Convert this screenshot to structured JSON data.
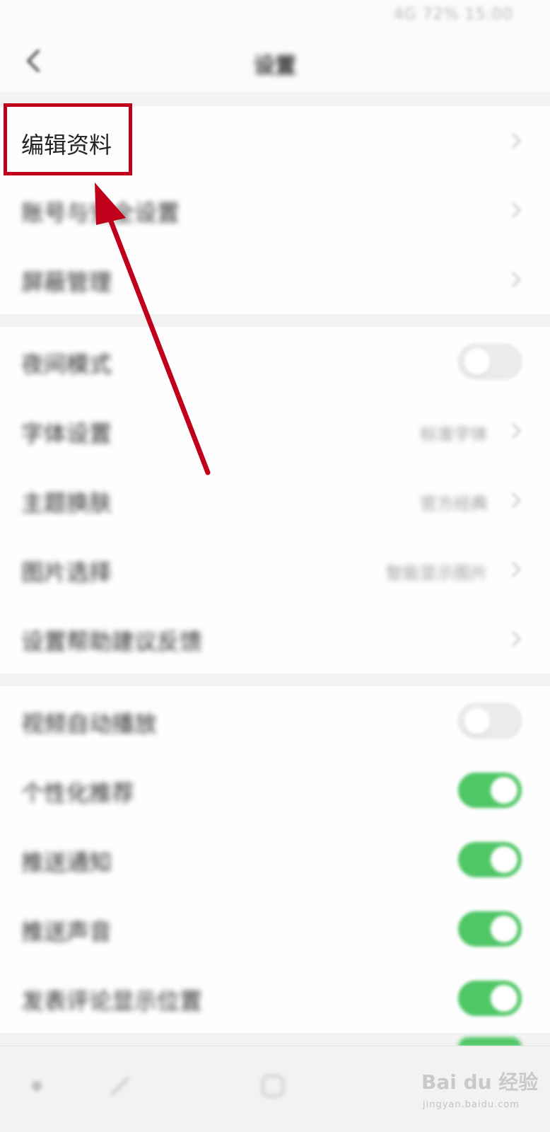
{
  "status_bar": {
    "text": "4G 72% 15:00"
  },
  "header": {
    "title": "设置"
  },
  "groups": [
    {
      "rows": [
        {
          "label": "编辑资料",
          "control": "chevron"
        },
        {
          "label": "账号与安全设置",
          "control": "chevron"
        },
        {
          "label": "屏蔽管理",
          "control": "chevron"
        }
      ]
    },
    {
      "rows": [
        {
          "label": "夜间模式",
          "control": "toggle-off"
        },
        {
          "label": "字体设置",
          "value": "标准字体",
          "control": "chevron"
        },
        {
          "label": "主题换肤",
          "value": "官方经典",
          "control": "chevron"
        },
        {
          "label": "图片选择",
          "value": "智能显示图片",
          "control": "chevron"
        },
        {
          "label": "设置帮助建议反馈",
          "control": "chevron"
        }
      ]
    },
    {
      "rows": [
        {
          "label": "视频自动播放",
          "control": "toggle-off"
        },
        {
          "label": "个性化推荐",
          "control": "toggle-on"
        },
        {
          "label": "推送通知",
          "control": "toggle-on"
        },
        {
          "label": "推送声音",
          "control": "toggle-on"
        },
        {
          "label": "发表评论显示位置",
          "control": "toggle-on"
        }
      ]
    }
  ],
  "watermark": {
    "main": "Bai du 经验",
    "sub": "jingyan.baidu.com"
  },
  "colors": {
    "toggle_on": "#4fc766",
    "annotation": "#c0001a"
  }
}
